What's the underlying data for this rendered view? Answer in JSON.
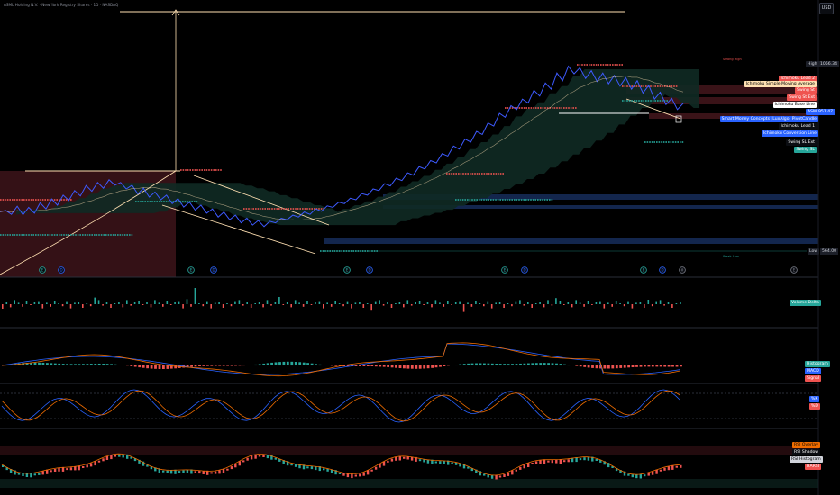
{
  "header": {
    "title": "ASML Holding N.V. · New York Registry Shares · 1D · NASDAQ",
    "currency": "USD"
  },
  "colors": {
    "bg": "#000000",
    "price_line": "#3d5afe",
    "bull": "#26a69a",
    "bear": "#ef5350",
    "trend_line": "#ffe0b2",
    "cloud_red": "#3b1016",
    "cloud_green": "#0f2a24",
    "zone_blue": "#13264d",
    "zone_red": "#3a1318"
  },
  "labels": {
    "high_title": "High",
    "high_value": "1056.34",
    "low_title": "Low",
    "low_value": "564.00",
    "symbol_title": "ASML",
    "symbol_value": "951.47",
    "high_annotation": "Strong High",
    "low_annotation": "Weak Low"
  },
  "tags": [
    {
      "text": "Ichimoku Lead 2",
      "bg": "#ef5350",
      "fg": "#ffffff"
    },
    {
      "text": "Ichimoku Simple Moving Average",
      "bg": "#ffe0b2",
      "fg": "#000000"
    },
    {
      "text": "Swing St",
      "bg": "#ef5350",
      "fg": "#ffffff"
    },
    {
      "text": "Swing St Ext",
      "bg": "#ef5350",
      "fg": "#ffffff"
    },
    {
      "text": "Ichimoku Base Line",
      "bg": "#ffffff",
      "fg": "#000000"
    },
    {
      "text": "Smart Money Concepts [LuxAlgo] PivotCandle",
      "bg": "#2962ff",
      "fg": "#ffffff"
    },
    {
      "text": "Ichimoku Lead 1",
      "bg": "#0b0d12",
      "fg": "#ffffff"
    },
    {
      "text": "Ichimoku Conversion Line",
      "bg": "#2962ff",
      "fg": "#ffffff"
    },
    {
      "text": "Swing SL Ext",
      "bg": "#0b0d12",
      "fg": "#ffffff"
    },
    {
      "text": "Swing SL",
      "bg": "#26a69a",
      "fg": "#ffffff"
    }
  ],
  "panes": {
    "volume": {
      "label": "Volume Delta"
    },
    "macd": {
      "labels": [
        "Histogram",
        "MACD",
        "Signal"
      ]
    },
    "stoch": {
      "labels": [
        "%K",
        "%D"
      ]
    },
    "rsi": {
      "labels": [
        "RSI Overlay",
        "RSI Shadow",
        "RSI Histogram",
        "HARSI"
      ]
    }
  },
  "chart_data": {
    "type": "line",
    "y_range": [
      564,
      1056.34
    ],
    "price": [
      669,
      672,
      662,
      683,
      661,
      680,
      665,
      692,
      676,
      702,
      686,
      712,
      698,
      724,
      710,
      737,
      722,
      745,
      730,
      752,
      738,
      745,
      728,
      738,
      715,
      730,
      707,
      720,
      700,
      712,
      690,
      703,
      681,
      694,
      673,
      686,
      665,
      676,
      655,
      668,
      648,
      660,
      640,
      652,
      634,
      646,
      630,
      644,
      640,
      652,
      648,
      660,
      655,
      668,
      662,
      676,
      670,
      684,
      680,
      694,
      690,
      704,
      700,
      716,
      712,
      728,
      724,
      742,
      736,
      756,
      750,
      770,
      764,
      786,
      780,
      802,
      796,
      820,
      814,
      840,
      832,
      858,
      850,
      878,
      870,
      900,
      892,
      925,
      915,
      945,
      935,
      962,
      952,
      985,
      970,
      1004,
      988,
      1030,
      1010,
      1048,
      1028,
      1044,
      1016,
      1036,
      1008,
      1030,
      1002,
      1024,
      996,
      1018,
      988,
      1010,
      978,
      998,
      962,
      980,
      948,
      964,
      935,
      951
    ]
  }
}
